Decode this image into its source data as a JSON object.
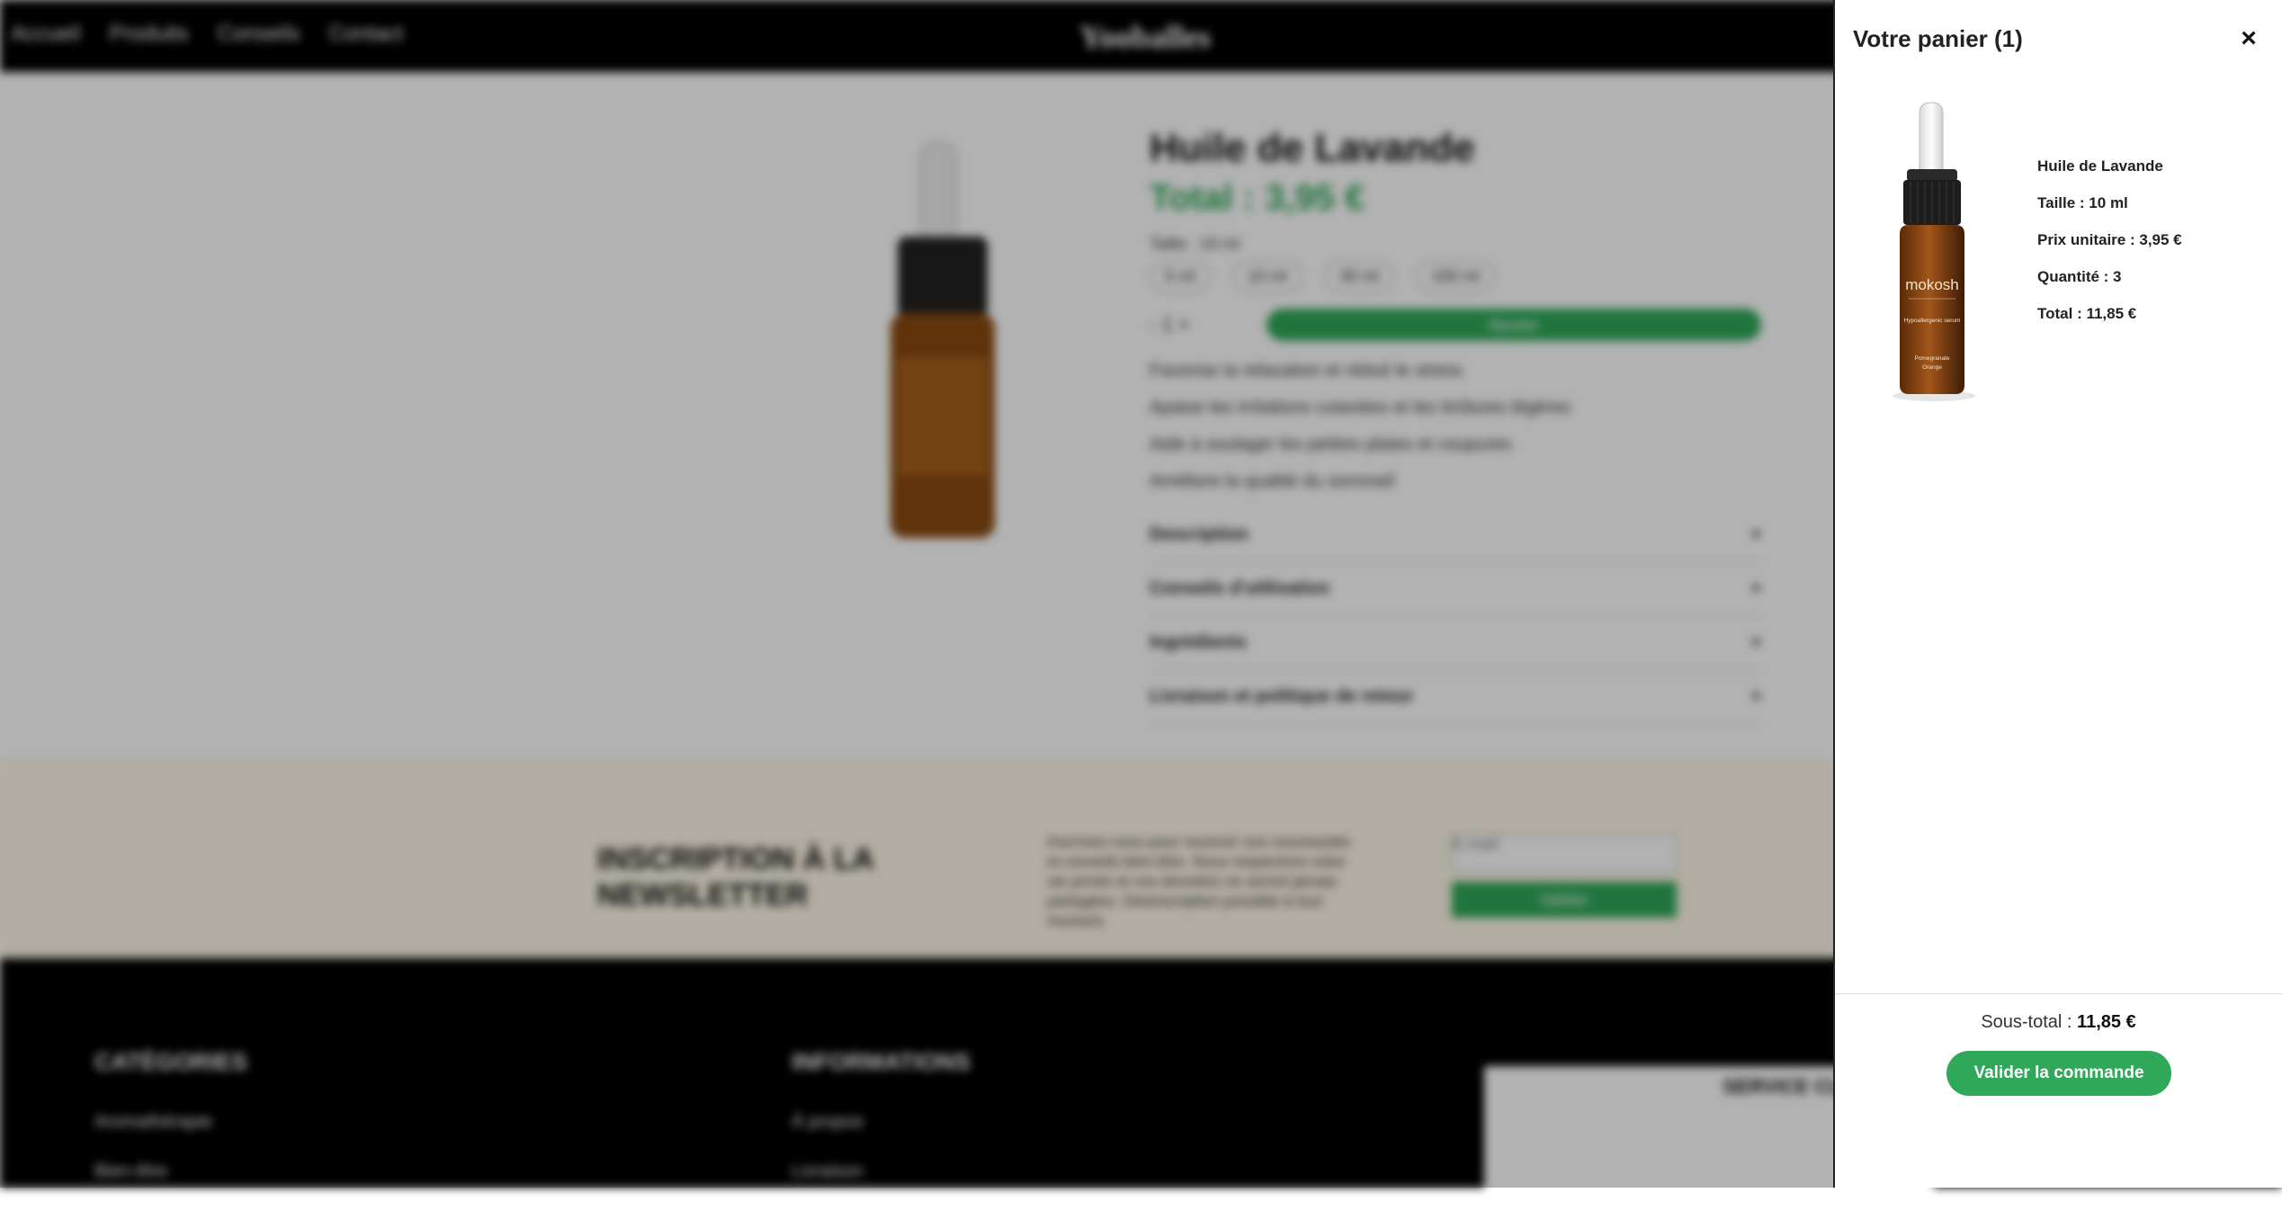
{
  "background_page": {
    "nav": {
      "links": [
        "Accueil",
        "Produits",
        "Conseils",
        "Contact"
      ],
      "brand": "Yooballes"
    },
    "product": {
      "title": "Huile de Lavande",
      "price": "Total : 3,95 €",
      "size_label": "Taille : 10 ml",
      "sizes": [
        "5 ml",
        "10 ml",
        "30 ml",
        "100 ml"
      ],
      "qty_display": "- 1 +",
      "add_label": "Ajouter",
      "bullets": [
        "Favorise la relaxation et réduit le stress",
        "Apaise les irritations cutanées et les brûlures légères",
        "Aide à soulager les petites plaies et coupures",
        "Améliore la qualité du sommeil"
      ],
      "accordions": [
        "Description",
        "Conseils d'utilisation",
        "Ingrédients",
        "Livraison et politique de retour"
      ]
    },
    "newsletter": {
      "title": "INSCRIPTION À LA NEWSLETTER",
      "text": "Inscrivez-vous pour recevoir nos nouveautés et conseils bien-être. Nous respectons votre vie privée et vos données ne seront jamais partagées. Désinscription possible à tout moment.",
      "email_placeholder": "E-mail",
      "button": "Valider"
    },
    "footer": {
      "col1_title": "CATÉGORIES",
      "col1_items": [
        "Aromathérapie",
        "Bien-être"
      ],
      "col2_title": "INFORMATIONS",
      "col2_items": [
        "À propos",
        "Livraison"
      ],
      "box_title": "SERVICE CLIENT"
    }
  },
  "cart": {
    "title": "Votre panier (1)",
    "close_symbol": "×",
    "item": {
      "name": "Huile de Lavande",
      "size": "Taille : 10 ml",
      "unit_price": "Prix unitaire : 3,95 €",
      "quantity": "Quantité : 3",
      "total": "Total : 11,85 €",
      "image_brand": "mokosh",
      "image_line1": "Hypoallergenic serum",
      "image_line2": "Pomegranate",
      "image_line3": "Orange"
    },
    "subtotal_label": "Sous-total :",
    "subtotal_value": "11,85 €",
    "checkout_label": "Valider la commande"
  },
  "colors": {
    "accent_green": "#2fa85a",
    "overlay": "rgba(0,0,0,0.30)"
  }
}
